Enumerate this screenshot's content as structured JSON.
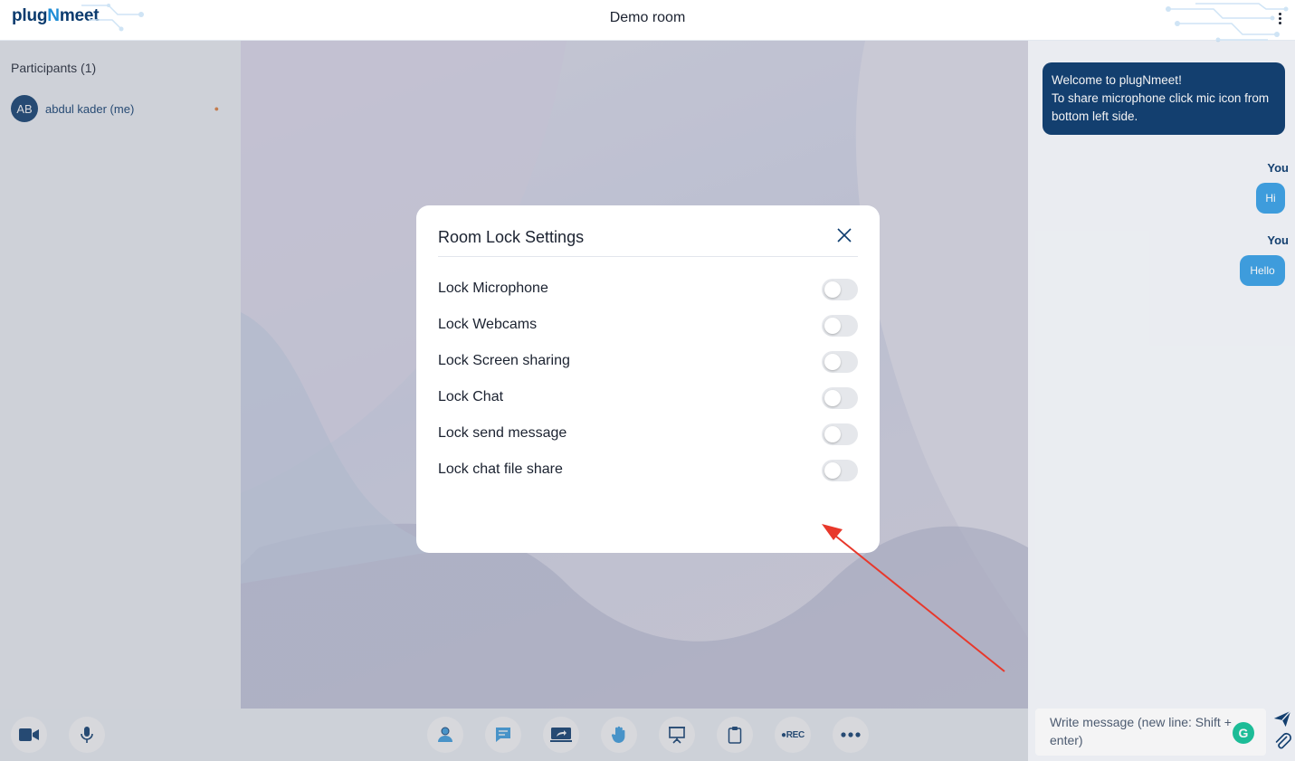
{
  "header": {
    "logo_prefix": "plug",
    "logo_n": "N",
    "logo_suffix": "meet",
    "room_title": "Demo room"
  },
  "participants": {
    "title": "Participants (1)",
    "items": [
      {
        "initials": "AB",
        "name": "abdul kader (me)"
      }
    ]
  },
  "chat": {
    "welcome_line1": "Welcome to plugNmeet!",
    "welcome_line2": "To share microphone click mic icon from bottom left side.",
    "messages": [
      {
        "sender": "You",
        "text": "Hi"
      },
      {
        "sender": "You",
        "text": "Hello"
      }
    ],
    "input_placeholder": "Write message (new line: Shift + enter)"
  },
  "toolbar": {
    "rec_label": "●REC"
  },
  "modal": {
    "title": "Room Lock Settings",
    "settings": [
      {
        "label": "Lock Microphone",
        "enabled": false
      },
      {
        "label": "Lock Webcams",
        "enabled": false
      },
      {
        "label": "Lock Screen sharing",
        "enabled": false
      },
      {
        "label": "Lock Chat",
        "enabled": false
      },
      {
        "label": "Lock send message",
        "enabled": false
      },
      {
        "label": "Lock chat file share",
        "enabled": false
      }
    ]
  },
  "colors": {
    "brand_dark": "#0b3b6e",
    "brand_light": "#1f8dd6",
    "bubble": "#3aa0e4",
    "annotation_arrow": "#e8382b"
  }
}
